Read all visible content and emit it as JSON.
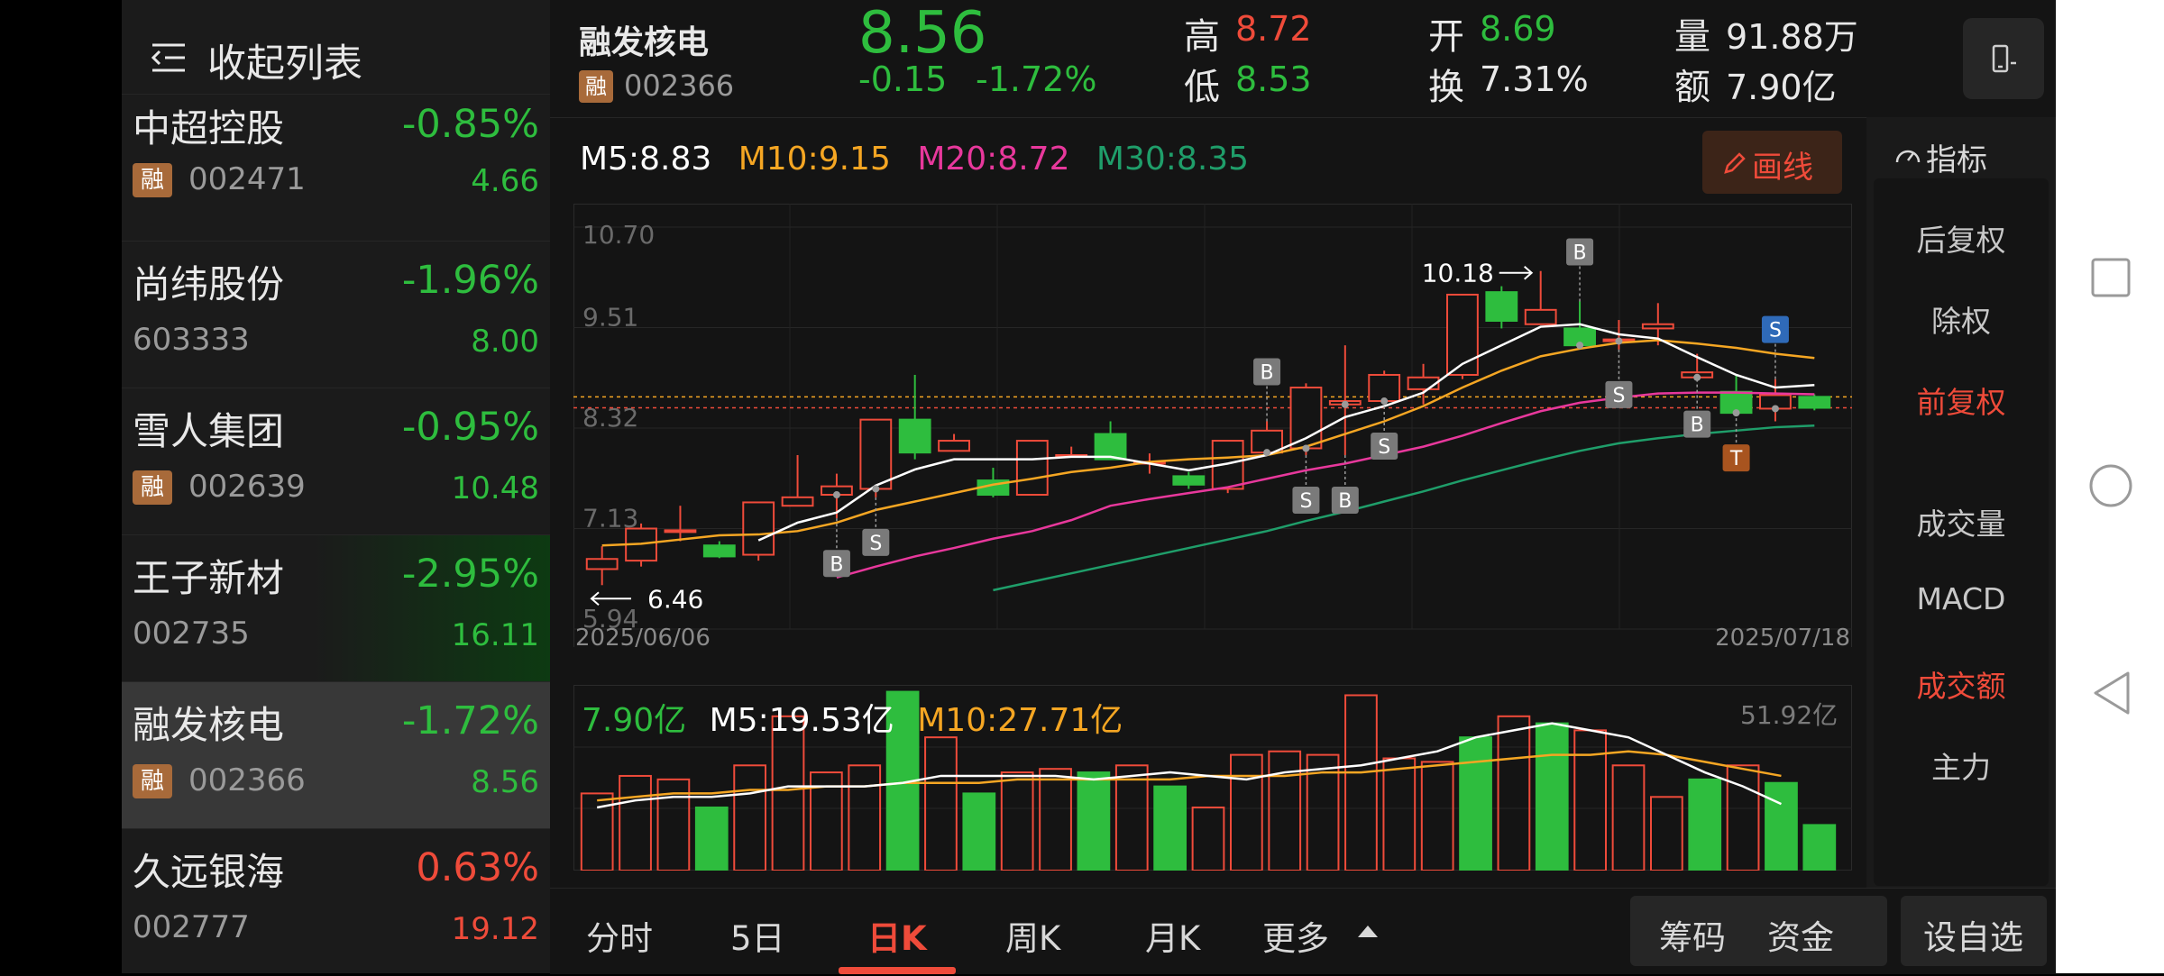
{
  "list": {
    "collapse_label": "收起列表",
    "items": [
      {
        "name": "中超控股",
        "pct": "-0.85%",
        "code": "002471",
        "price": "4.66",
        "margin": true,
        "dir": "down"
      },
      {
        "name": "尚纬股份",
        "pct": "-1.96%",
        "code": "603333",
        "price": "8.00",
        "margin": false,
        "dir": "down"
      },
      {
        "name": "雪人集团",
        "pct": "-0.95%",
        "code": "002639",
        "price": "10.48",
        "margin": true,
        "dir": "down"
      },
      {
        "name": "王子新材",
        "pct": "-2.95%",
        "code": "002735",
        "price": "16.11",
        "margin": false,
        "dir": "down"
      },
      {
        "name": "融发核电",
        "pct": "-1.72%",
        "code": "002366",
        "price": "8.56",
        "margin": true,
        "dir": "down",
        "selected": true
      },
      {
        "name": "久远银海",
        "pct": "0.63%",
        "code": "002777",
        "price": "19.12",
        "margin": false,
        "dir": "up"
      }
    ],
    "margin_badge": "融"
  },
  "quote": {
    "name": "融发核电",
    "code": "002366",
    "margin_badge": "融",
    "price": "8.56",
    "change": "-0.15",
    "change_pct": "-1.72%",
    "high_label": "高",
    "high": "8.72",
    "low_label": "低",
    "low": "8.53",
    "open_label": "开",
    "open": "8.69",
    "turnover_label": "换",
    "turnover": "7.31%",
    "volume_label": "量",
    "volume": "91.88万",
    "amount_label": "额",
    "amount": "7.90亿"
  },
  "ma_legend": {
    "m5": "M5:8.83",
    "m10": "M10:9.15",
    "m20": "M20:8.72",
    "m30": "M30:8.35"
  },
  "draw_button": "画线",
  "indicator_button": "指标",
  "indicator_items": [
    "后复权",
    "除权",
    "前复权",
    "成交量",
    "MACD",
    "成交额",
    "主力"
  ],
  "indicator_active": [
    "前复权",
    "成交额"
  ],
  "vol_legend": {
    "today": "7.90亿",
    "m5": "M5:19.53亿",
    "m10": "M10:27.71亿",
    "max": "51.92亿"
  },
  "tabs": [
    "分时",
    "5日",
    "日K",
    "周K",
    "月K",
    "更多"
  ],
  "active_tab": "日K",
  "right_buttons": {
    "chips": "筹码",
    "funds": "资金",
    "watch": "设自选"
  },
  "colors": {
    "up": "#ef4b3a",
    "down": "#2ebd3e",
    "m5": "#ffffff",
    "m10": "#f5a623",
    "m20": "#e8389c",
    "m30": "#1f9e6a",
    "accent": "#ef4b3a"
  },
  "chart_data": {
    "type": "candlestick",
    "yticks": [
      "10.70",
      "9.51",
      "8.32",
      "7.13",
      "5.94"
    ],
    "ylim": [
      5.94,
      10.7
    ],
    "x_start": "2025/06/06",
    "x_end": "2025/07/18",
    "max_label": "10.18",
    "min_label": "6.46",
    "candles": [
      {
        "o": 6.65,
        "c": 6.77,
        "h": 6.92,
        "l": 6.46
      },
      {
        "o": 6.75,
        "c": 7.13,
        "h": 7.19,
        "l": 6.68
      },
      {
        "o": 7.11,
        "c": 7.11,
        "h": 7.4,
        "l": 6.98
      },
      {
        "o": 6.93,
        "c": 6.8,
        "h": 6.98,
        "l": 6.78
      },
      {
        "o": 6.82,
        "c": 7.44,
        "h": 7.44,
        "l": 6.75
      },
      {
        "o": 7.4,
        "c": 7.5,
        "h": 8.0,
        "l": 7.4
      },
      {
        "o": 7.53,
        "c": 7.63,
        "h": 7.78,
        "l": 7.25
      },
      {
        "o": 7.6,
        "c": 8.42,
        "h": 8.42,
        "l": 7.5
      },
      {
        "o": 8.42,
        "c": 8.03,
        "h": 8.95,
        "l": 7.95
      },
      {
        "o": 8.05,
        "c": 8.17,
        "h": 8.25,
        "l": 8.05
      },
      {
        "o": 7.7,
        "c": 7.53,
        "h": 7.85,
        "l": 7.5
      },
      {
        "o": 7.53,
        "c": 8.17,
        "h": 8.17,
        "l": 7.53
      },
      {
        "o": 8.0,
        "c": 8.0,
        "h": 8.1,
        "l": 7.97
      },
      {
        "o": 8.25,
        "c": 7.95,
        "h": 8.4,
        "l": 7.95
      },
      {
        "o": 7.92,
        "c": 7.92,
        "h": 8.02,
        "l": 7.78
      },
      {
        "o": 7.75,
        "c": 7.65,
        "h": 7.8,
        "l": 7.6
      },
      {
        "o": 7.6,
        "c": 8.17,
        "h": 8.17,
        "l": 7.55
      },
      {
        "o": 8.03,
        "c": 8.29,
        "h": 8.4,
        "l": 8.0
      },
      {
        "o": 8.08,
        "c": 8.8,
        "h": 8.85,
        "l": 8.0
      },
      {
        "o": 8.6,
        "c": 8.64,
        "h": 9.3,
        "l": 8.0
      },
      {
        "o": 8.64,
        "c": 8.95,
        "h": 9.0,
        "l": 8.64
      },
      {
        "o": 8.78,
        "c": 8.92,
        "h": 9.08,
        "l": 8.6
      },
      {
        "o": 8.95,
        "c": 9.9,
        "h": 9.9,
        "l": 8.9
      },
      {
        "o": 9.93,
        "c": 9.59,
        "h": 10.0,
        "l": 9.5
      },
      {
        "o": 9.55,
        "c": 9.72,
        "h": 10.18,
        "l": 9.55
      },
      {
        "o": 9.5,
        "c": 9.3,
        "h": 9.82,
        "l": 9.27
      },
      {
        "o": 9.35,
        "c": 9.37,
        "h": 9.6,
        "l": 9.25
      },
      {
        "o": 9.5,
        "c": 9.55,
        "h": 9.8,
        "l": 9.3
      },
      {
        "o": 8.92,
        "c": 8.98,
        "h": 9.2,
        "l": 8.9
      },
      {
        "o": 8.75,
        "c": 8.5,
        "h": 8.95,
        "l": 8.5
      },
      {
        "o": 8.55,
        "c": 8.71,
        "h": 8.9,
        "l": 8.4
      },
      {
        "o": 8.69,
        "c": 8.56,
        "h": 8.72,
        "l": 8.53
      }
    ],
    "ma5": [
      null,
      null,
      null,
      null,
      6.99,
      7.2,
      7.32,
      7.64,
      7.83,
      7.95,
      7.95,
      7.95,
      7.98,
      7.98,
      7.9,
      7.82,
      7.9,
      8.0,
      8.2,
      8.45,
      8.58,
      8.74,
      9.08,
      9.3,
      9.52,
      9.55,
      9.43,
      9.38,
      9.16,
      8.95,
      8.8,
      8.83
    ],
    "ma10": [
      6.93,
      6.95,
      7.0,
      7.05,
      7.06,
      7.1,
      7.2,
      7.35,
      7.45,
      7.55,
      7.65,
      7.72,
      7.8,
      7.85,
      7.92,
      7.95,
      7.97,
      8.0,
      8.1,
      8.25,
      8.4,
      8.58,
      8.8,
      9.0,
      9.17,
      9.26,
      9.33,
      9.36,
      9.32,
      9.27,
      9.2,
      9.15
    ],
    "ma20": [
      null,
      null,
      null,
      null,
      null,
      null,
      6.55,
      6.68,
      6.8,
      6.9,
      7.01,
      7.1,
      7.23,
      7.4,
      7.48,
      7.55,
      7.62,
      7.72,
      7.82,
      7.9,
      8.0,
      8.1,
      8.23,
      8.38,
      8.52,
      8.62,
      8.68,
      8.73,
      8.74,
      8.74,
      8.73,
      8.72
    ],
    "ma30": [
      null,
      null,
      null,
      null,
      null,
      null,
      null,
      null,
      null,
      null,
      6.4,
      6.5,
      6.6,
      6.7,
      6.8,
      6.9,
      7.0,
      7.1,
      7.22,
      7.33,
      7.45,
      7.57,
      7.7,
      7.82,
      7.94,
      8.05,
      8.14,
      8.2,
      8.25,
      8.29,
      8.33,
      8.35
    ],
    "bs_marks": [
      {
        "i": 6,
        "label": "B",
        "pos": "below"
      },
      {
        "i": 7,
        "label": "S",
        "pos": "below"
      },
      {
        "i": 17,
        "label": "B",
        "pos": "above"
      },
      {
        "i": 18,
        "label": "S",
        "pos": "below"
      },
      {
        "i": 19,
        "label": "B",
        "pos": "below"
      },
      {
        "i": 20,
        "label": "S",
        "pos": "below"
      },
      {
        "i": 25,
        "label": "B",
        "pos": "above"
      },
      {
        "i": 26,
        "label": "S",
        "pos": "below"
      },
      {
        "i": 28,
        "label": "B",
        "pos": "below"
      },
      {
        "i": 29,
        "label": "T",
        "pos": "below"
      },
      {
        "i": 30,
        "label": "S",
        "pos": "above"
      }
    ],
    "amount": [
      22,
      27,
      26,
      18,
      30,
      44,
      28,
      30,
      51,
      38,
      22,
      28,
      29,
      28,
      30,
      24,
      18,
      33,
      34,
      33,
      50,
      32,
      31,
      38,
      44,
      42,
      40,
      30,
      21,
      26,
      30,
      25,
      13
    ],
    "amount_ma5": [
      18,
      20,
      21,
      21,
      22,
      24,
      24,
      24,
      25,
      27,
      27,
      27,
      27,
      26,
      27,
      28,
      27,
      26,
      28,
      29,
      30,
      32,
      34,
      38,
      40,
      42,
      40,
      38,
      33,
      28,
      24,
      19
    ],
    "amount_ma10": [
      20,
      21,
      22,
      22,
      23,
      23,
      24,
      24,
      25,
      25,
      25,
      26,
      26,
      26,
      26,
      26,
      27,
      27,
      27,
      28,
      28,
      29,
      30,
      31,
      32,
      33,
      33,
      34,
      33,
      31,
      29,
      27
    ]
  }
}
